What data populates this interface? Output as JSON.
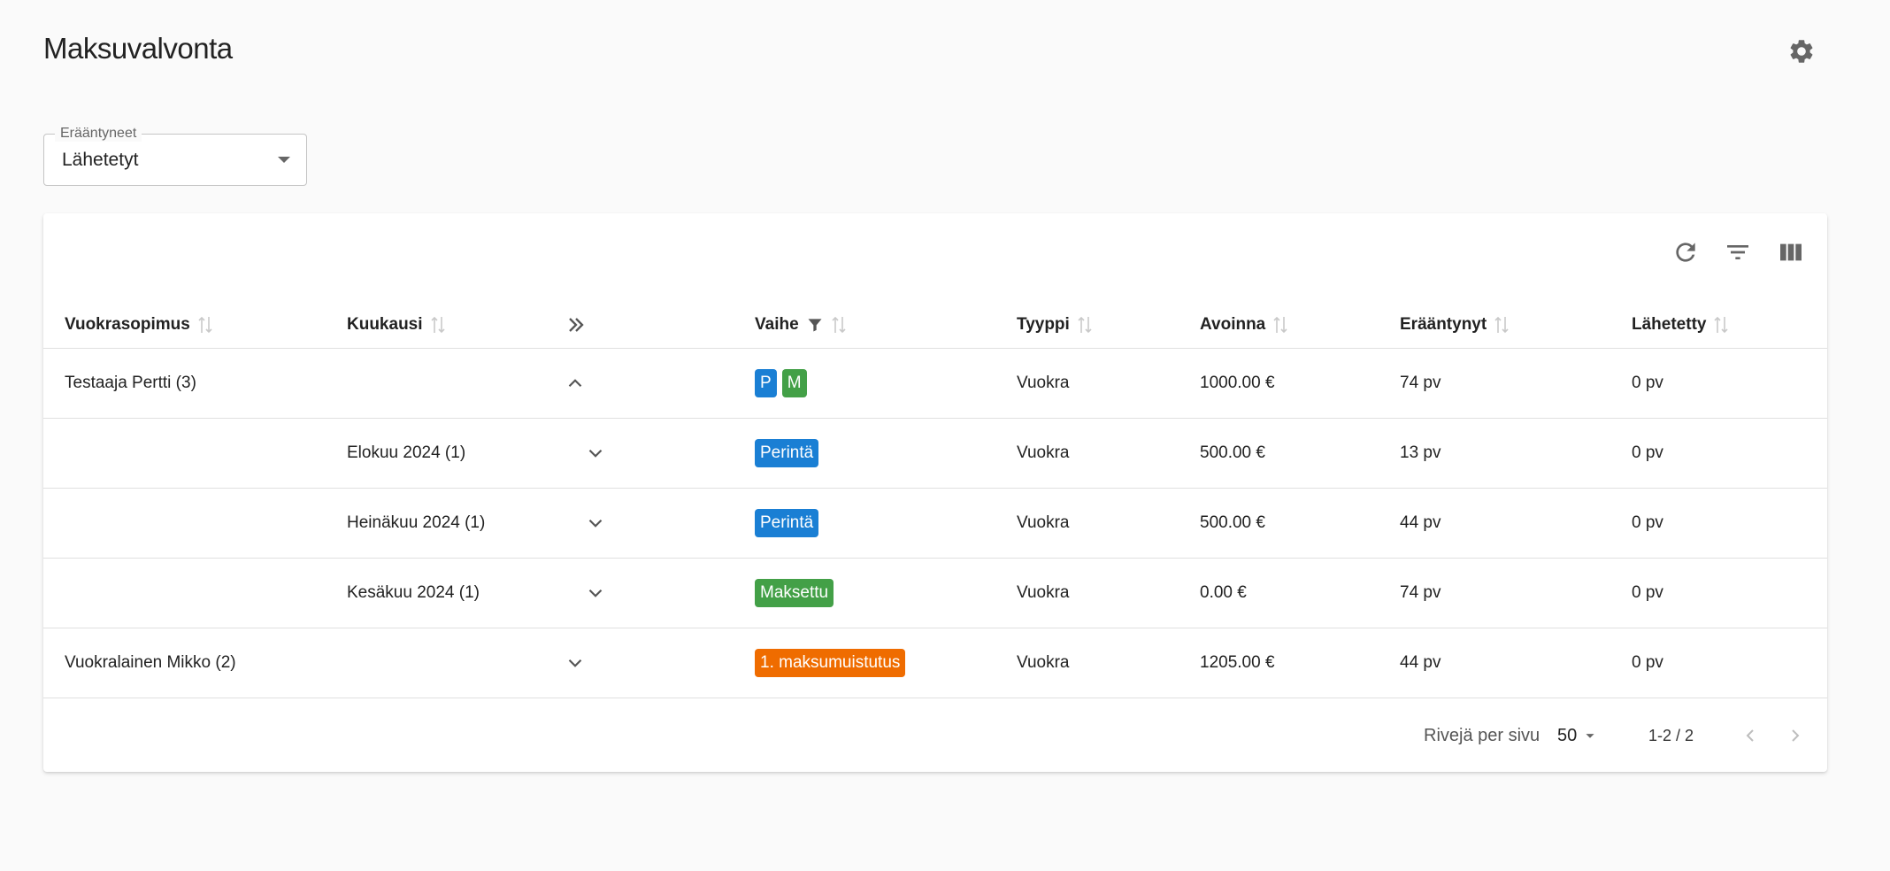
{
  "page": {
    "title": "Maksuvalvonta"
  },
  "filter": {
    "label": "Erääntyneet",
    "value": "Lähetetyt"
  },
  "table": {
    "headers": {
      "contract": "Vuokrasopimus",
      "month": "Kuukausi",
      "phase": "Vaihe",
      "type": "Tyyppi",
      "open": "Avoinna",
      "overdue": "Erääntynyt",
      "sent": "Lähetetty"
    },
    "rows": [
      {
        "contract": "Testaaja Pertti (3)",
        "month": "",
        "chips": [
          {
            "text": "P",
            "color": "#1a7fd4"
          },
          {
            "text": "M",
            "color": "#43a047"
          }
        ],
        "type": "Vuokra",
        "open": "1000.00 €",
        "overdue": "74 pv",
        "sent": "0 pv"
      },
      {
        "contract": "",
        "month": "Elokuu 2024 (1)",
        "chips": [
          {
            "text": "Perintä",
            "color": "#1a7fd4"
          }
        ],
        "type": "Vuokra",
        "open": "500.00 €",
        "overdue": "13 pv",
        "sent": "0 pv"
      },
      {
        "contract": "",
        "month": "Heinäkuu 2024 (1)",
        "chips": [
          {
            "text": "Perintä",
            "color": "#1a7fd4"
          }
        ],
        "type": "Vuokra",
        "open": "500.00 €",
        "overdue": "44 pv",
        "sent": "0 pv"
      },
      {
        "contract": "",
        "month": "Kesäkuu 2024 (1)",
        "chips": [
          {
            "text": "Maksettu",
            "color": "#43a047"
          }
        ],
        "type": "Vuokra",
        "open": "0.00 €",
        "overdue": "74 pv",
        "sent": "0 pv"
      },
      {
        "contract": "Vuokralainen Mikko (2)",
        "month": "",
        "chips": [
          {
            "text": "1. maksumuistutus",
            "color": "#ef6c00"
          }
        ],
        "type": "Vuokra",
        "open": "1205.00 €",
        "overdue": "44 pv",
        "sent": "0 pv"
      }
    ]
  },
  "pagination": {
    "rows_label": "Rivejä per sivu",
    "rows_value": "50",
    "range": "1-2 / 2"
  },
  "colors": {
    "blue": "#1a7fd4",
    "green": "#43a047",
    "orange": "#ef6c00",
    "icon_grey": "#666666"
  },
  "icons": [
    "gear-icon",
    "refresh-icon",
    "filter-list-icon",
    "view-columns-icon",
    "sort-icon",
    "filter-funnel-icon",
    "expand-all-icon",
    "chevron-up-icon",
    "chevron-down-icon",
    "chevron-left-icon",
    "chevron-right-icon"
  ]
}
